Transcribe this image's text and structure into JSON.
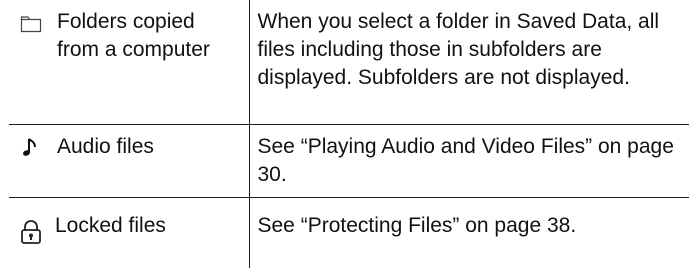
{
  "table": {
    "rows": [
      {
        "type_label": "Folders copied from a computer",
        "icon": "folder-icon",
        "description": "When you select a folder in Saved Data, all files including those in subfolders are displayed. Subfolders are not displayed."
      },
      {
        "type_label": "Audio files",
        "icon": "music-note-icon",
        "description": "See “Playing Audio and Video Files” on page 30."
      },
      {
        "type_label": "Locked files",
        "icon": "lock-icon",
        "description": "See “Protecting Files” on page 38."
      }
    ]
  }
}
